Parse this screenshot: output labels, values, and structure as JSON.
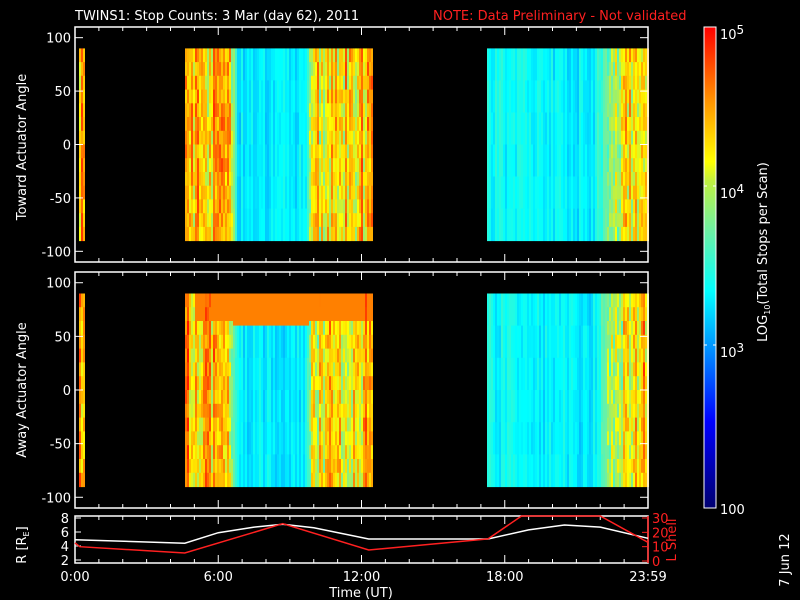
{
  "chart_data": [
    {
      "type": "heatmap",
      "title": "TWINS1: Stop Counts:  3 Mar (day  62), 2011",
      "note": "NOTE: Data Preliminary - Not validated",
      "ylabel": "Toward Actuator Angle",
      "ylim": [
        -110,
        110
      ],
      "yticks": [
        "100",
        "50",
        "0",
        "-50",
        "-100"
      ],
      "xlim_hours": [
        0,
        24
      ],
      "data_segments_hours": [
        [
          0.1,
          0.4
        ],
        [
          4.6,
          12.4
        ],
        [
          17.2,
          24
        ]
      ],
      "segment_levels_log10": [
        [
          [
            0.1,
            4.5
          ],
          [
            0.4,
            4.5
          ]
        ],
        [
          [
            4.6,
            4.5
          ],
          [
            6.4,
            4.3
          ],
          [
            6.8,
            3.3
          ],
          [
            9.6,
            3.3
          ],
          [
            9.9,
            4.2
          ],
          [
            12.4,
            4.4
          ]
        ],
        [
          [
            17.2,
            3.4
          ],
          [
            21.7,
            3.3
          ],
          [
            22.5,
            4.0
          ],
          [
            24,
            4.4
          ]
        ]
      ]
    },
    {
      "type": "heatmap",
      "ylabel": "Away Actuator Angle",
      "ylim": [
        -110,
        110
      ],
      "yticks": [
        "100",
        "50",
        "0",
        "-50",
        "-100"
      ],
      "xlim_hours": [
        0,
        24
      ],
      "data_segments_hours": [
        [
          0.1,
          0.4
        ],
        [
          4.6,
          12.4
        ],
        [
          17.2,
          24
        ]
      ],
      "high_band_deg": [
        70,
        85
      ]
    },
    {
      "type": "line",
      "xlabel": "Time (UT)",
      "xticks": [
        "0:00",
        "6:00",
        "12:00",
        "18:00",
        "23:59"
      ],
      "ylabel": "R [R",
      "ylabel_sub": "E",
      "ylabel_end": "]",
      "yticks": [
        "2",
        "4",
        "6",
        "8"
      ],
      "y2label": "L Shell",
      "y2ticks": [
        "0",
        "10",
        "20",
        "30"
      ],
      "series": [
        {
          "name": "R",
          "color": "#ffffff",
          "x": [
            0,
            4.6,
            6,
            7.5,
            8.7,
            10,
            12.3,
            17.3,
            19,
            20.5,
            22,
            24
          ],
          "y": [
            4.9,
            4.4,
            5.9,
            6.7,
            7.1,
            6.6,
            5.0,
            5.0,
            6.3,
            7.0,
            6.7,
            5.1
          ]
        },
        {
          "name": "L Shell",
          "color": "#ff2020",
          "axis": "right",
          "x": [
            0,
            0.2,
            4.6,
            8.7,
            12.3,
            17.3,
            18.7,
            22,
            24
          ],
          "y": [
            12.6,
            10,
            5.6,
            26,
            7.7,
            15.4,
            32,
            32,
            13
          ]
        }
      ],
      "ylim": [
        1.5,
        8.3
      ],
      "y2lim": [
        -1,
        31
      ]
    }
  ],
  "colorbar": {
    "label": "LOG",
    "label_sub": "10",
    "label_end": "(Total Stops per Scan)",
    "ticks": [
      {
        "base": "10",
        "exp": "5"
      },
      {
        "base": "10",
        "exp": "4"
      },
      {
        "base": "10",
        "exp": "3"
      }
    ],
    "min_label": "100",
    "range_log10": [
      2,
      5
    ]
  },
  "side_date": "7 Jun 12"
}
